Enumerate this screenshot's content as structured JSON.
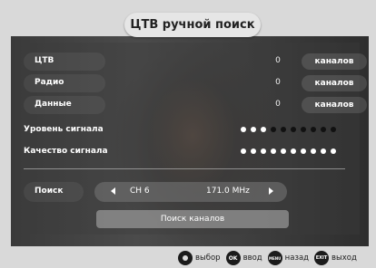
{
  "title": "ЦТВ ручной поиск",
  "rows": [
    {
      "label": "ЦТВ",
      "value": "0",
      "unit": "каналов"
    },
    {
      "label": "Радио",
      "value": "0",
      "unit": "каналов"
    },
    {
      "label": "Данные",
      "value": "0",
      "unit": "каналов"
    }
  ],
  "signal_level": {
    "label": "Уровень сигнала",
    "filled": 3,
    "total": 10
  },
  "signal_quality": {
    "label": "Качество сигнала",
    "filled": 10,
    "total": 10
  },
  "search": {
    "label": "Поиск",
    "channel": "CH 6",
    "frequency": "171.0 MHz"
  },
  "scan_button": "Поиск каналов",
  "footer": [
    {
      "icon": "dpad-icon",
      "icon_text": "",
      "label": "выбор"
    },
    {
      "icon": "ok-icon",
      "icon_text": "OK",
      "label": "ввод"
    },
    {
      "icon": "menu-icon",
      "icon_text": "MENU",
      "label": "назад"
    },
    {
      "icon": "exit-icon",
      "icon_text": "EXIT",
      "label": "выход"
    }
  ]
}
